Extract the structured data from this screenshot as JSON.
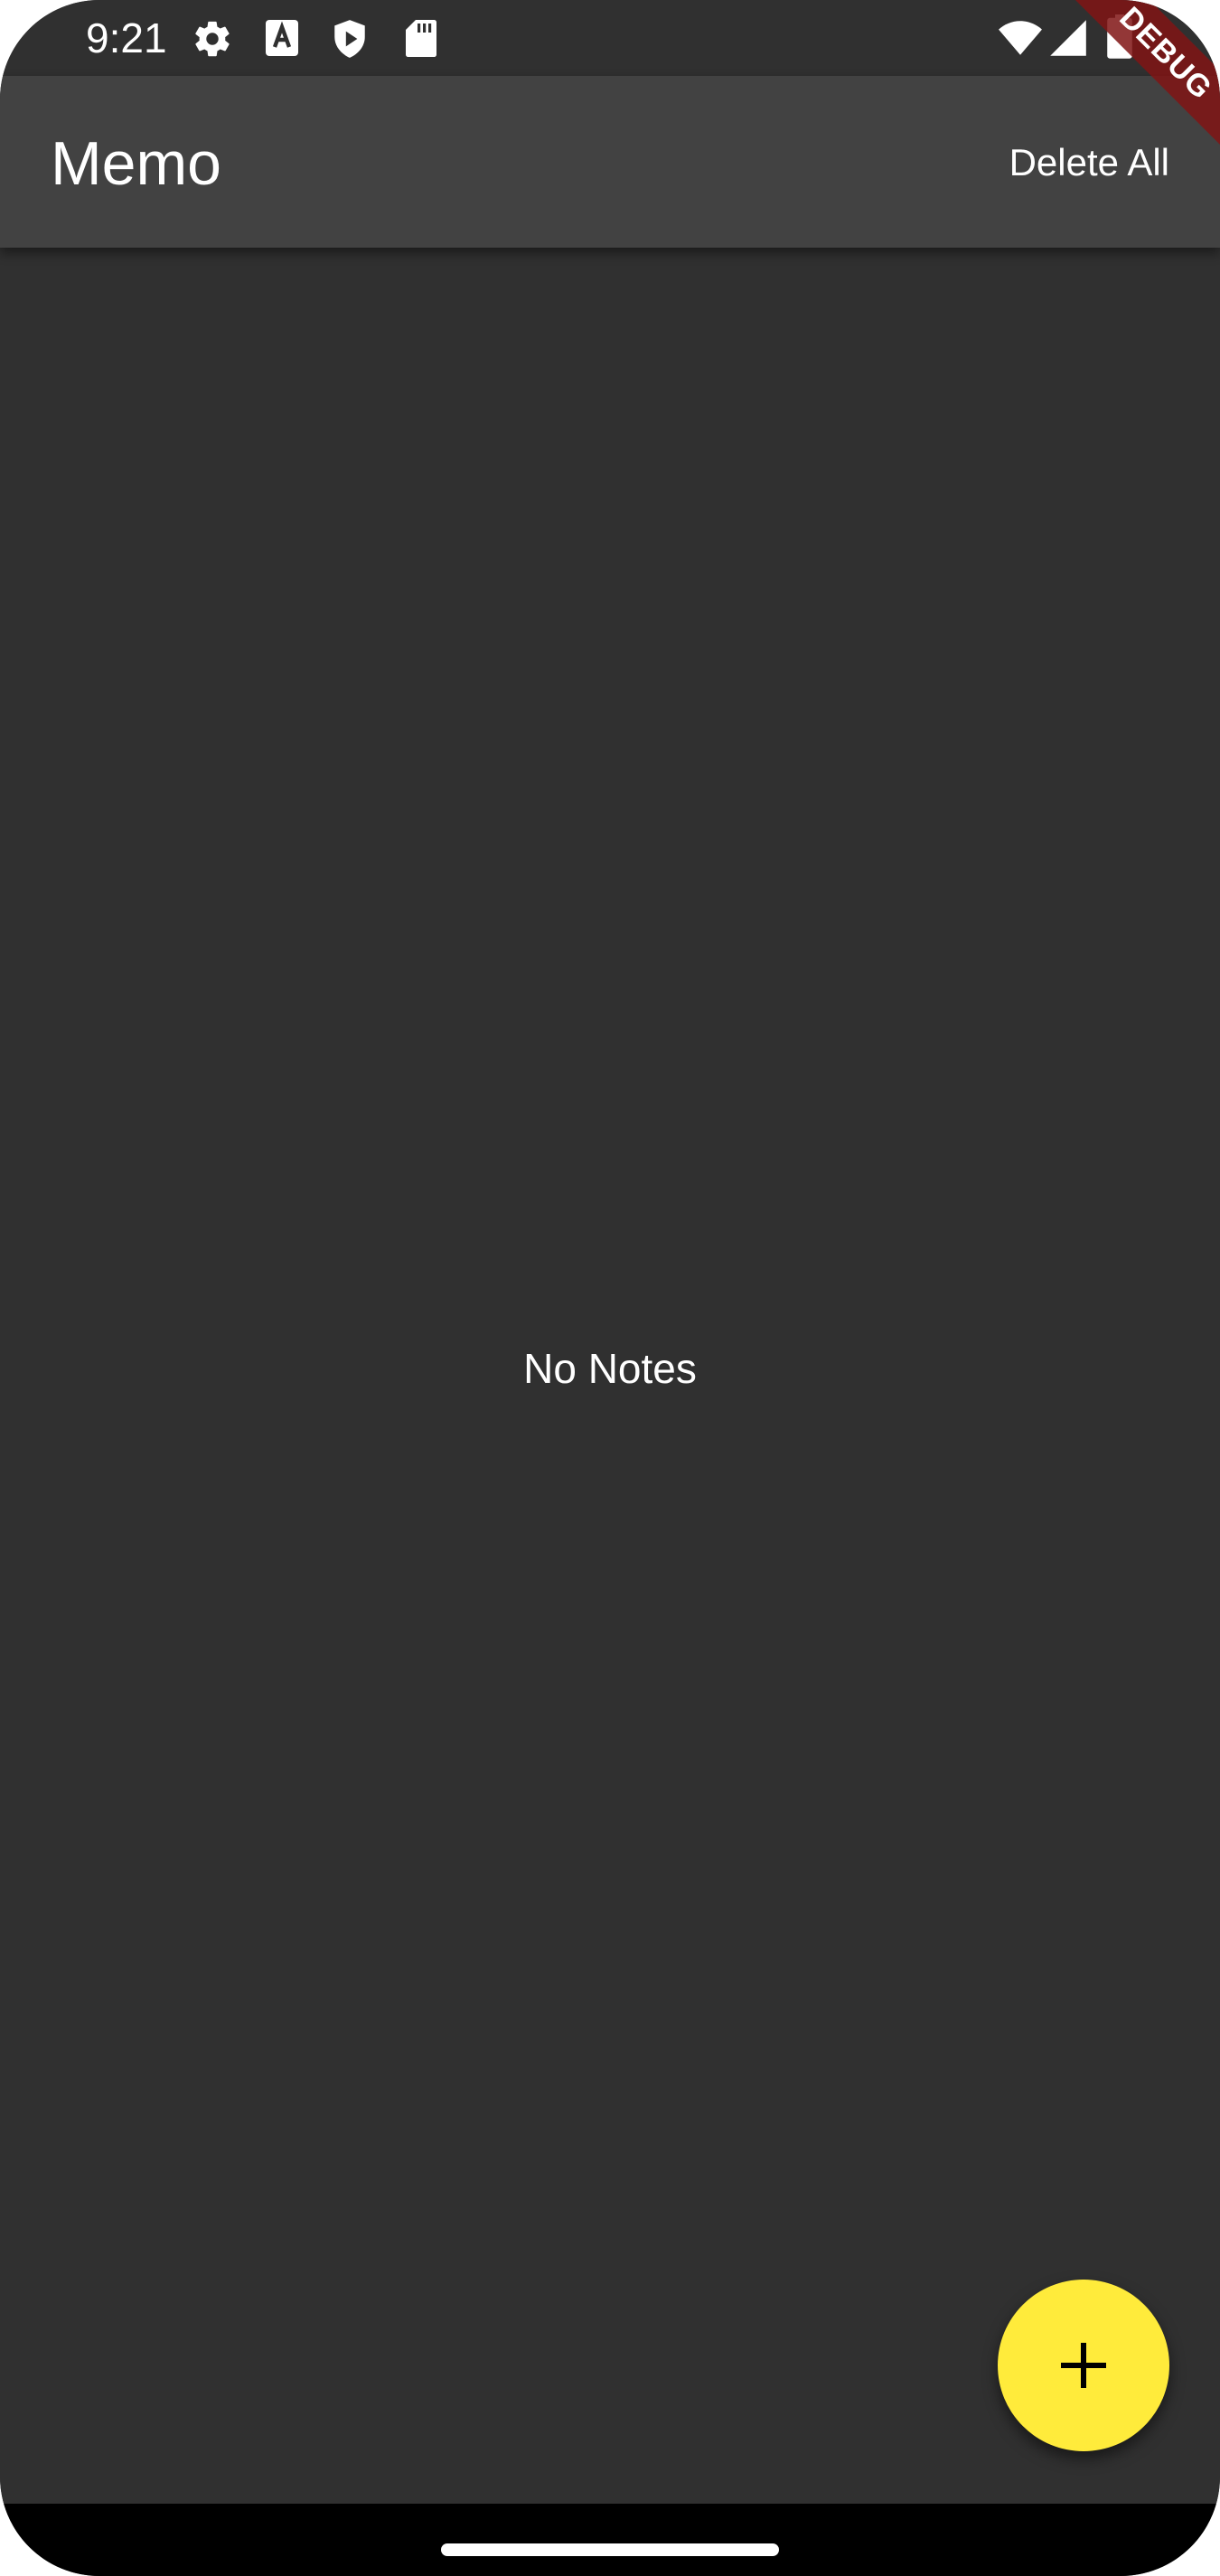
{
  "status_bar": {
    "time": "9:21",
    "left_icons": [
      "settings-icon",
      "text-a-icon",
      "play-shield-icon",
      "sd-card-icon"
    ],
    "right_icons": [
      "wifi-icon",
      "signal-icon",
      "battery-icon"
    ]
  },
  "app_bar": {
    "title": "Memo",
    "delete_all_label": "Delete All"
  },
  "main": {
    "empty_message": "No Notes"
  },
  "fab": {
    "icon": "plus-icon",
    "color": "#ffeb3b"
  },
  "debug_banner": {
    "label": "DEBUG"
  },
  "colors": {
    "background": "#303030",
    "app_bar": "#424242",
    "accent": "#ffeb3b",
    "debug_banner": "#801414"
  }
}
